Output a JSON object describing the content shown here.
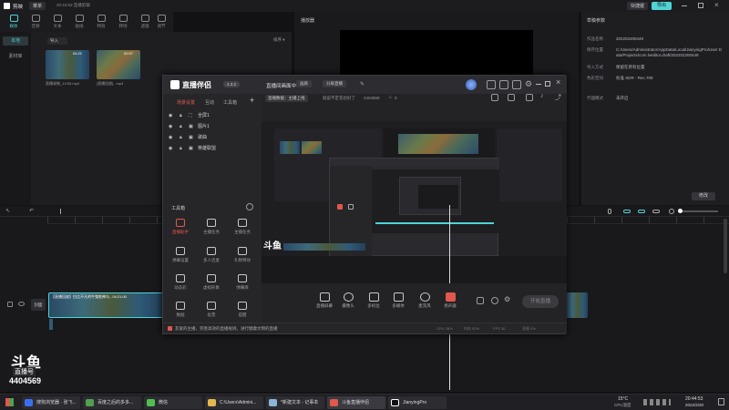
{
  "editor": {
    "app_name": "剪映",
    "menu": "菜单",
    "project_title": "20:44:53 直播剪辑",
    "export": "导出",
    "top_right": "快捷键",
    "nav": [
      "媒体",
      "音频",
      "文本",
      "贴纸",
      "特效",
      "转场",
      "滤镜",
      "调节"
    ],
    "side": [
      "本地",
      "素材库"
    ],
    "media_import": "导入",
    "media_sort": "排序",
    "clips": [
      {
        "name": "直播录制_19:53.mp4",
        "duration": "04:21"
      },
      {
        "name": "[直播回放]...mp4",
        "duration": "02:07"
      }
    ],
    "player_title": "播放器",
    "props_title": "草稿参数",
    "props": [
      {
        "label": "作品名称",
        "value": "202202200449"
      },
      {
        "label": "保存位置",
        "value": "C:/Users/Administrator/AppData/Local/JianyingPro/User Data/Projects/com.lveditor.draft/202202200449"
      },
      {
        "label": "导入方式",
        "value": "保留在原有位置"
      },
      {
        "label": "色彩空间",
        "value": "标准 SDR - Rec.709"
      },
      {
        "label": "代理模式",
        "value": "未开启"
      }
    ],
    "props_button": "修改",
    "track_label": "封面",
    "clip_label": "【直播回放】拉比不凡的牛鬼蛇神与...04:21:00"
  },
  "overlay": {
    "brand": "直播伴侣",
    "badge": "4.3.2",
    "scene_tabs": [
      "场景设置",
      "互动",
      "工具箱"
    ],
    "scenes": [
      "全屏1",
      "图片1",
      "歌曲",
      "英雄联盟"
    ],
    "toolbox_title": "工具箱",
    "tools": [
      [
        "直播助手",
        "主播任务",
        "主播任务"
      ],
      [
        "弹幕设置",
        "多人连麦",
        "礼物特效"
      ],
      [
        "动态彩",
        "虚拟形象",
        "弹幕库"
      ],
      [
        "数据",
        "投票",
        "提醒"
      ]
    ],
    "header_title": "直播间画面中",
    "header_btn1": "画质",
    "header_btn2": "分屏直播",
    "stats_btn": "直播数据：主播上线",
    "stats_text": "就说不定花也好了",
    "stats_value": "4404569",
    "stats_count": "0",
    "controls": [
      "直播屏幕",
      "摄像头",
      "多机位",
      "多媒体",
      "麦克风",
      "扬声器"
    ],
    "start_button": "开始直播",
    "notice": "友爱的主播，完善高效的直播规则，进行健康文明的直播",
    "status": [
      "CPU 28%",
      "内存 52%",
      "FPS 30",
      "丢帧 0%"
    ]
  },
  "watermark": {
    "brand": "斗鱼",
    "sub": "直播号",
    "room_id": "4404569"
  },
  "taskbar": {
    "items": [
      "搜狗浏览器 · 张飞...",
      "百度之后的多多...",
      "微信",
      "C:\\Users\\Admini...",
      "*新建文本 - 记事本",
      "斗鱼直播伴侣",
      "JianyingPro"
    ],
    "weather": "15°C",
    "weather_sub": "CPU温度",
    "time": "20:44:53",
    "date": "2022/2/20"
  },
  "colors": {
    "accent": "#4fd3d6",
    "red": "#e0574d",
    "blue": "#3a6ff0"
  }
}
